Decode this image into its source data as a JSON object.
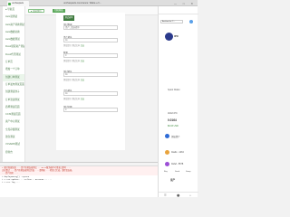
{
  "browser": {
    "tab_title": "unchaspads",
    "page_title": "unchaspads.com/vance: Waba ≡ h...",
    "window_controls": "— □ ✕"
  },
  "nav": {
    "items": [
      {
        "label": "● 导航页"
      },
      {
        "label": "Auto流测试"
      },
      {
        "label": "Auto资产转换测试"
      },
      {
        "label": "Auto数据切换"
      },
      {
        "label": "Auto数据测试"
      },
      {
        "label": "Fixed流程资产测试"
      },
      {
        "label": "Fixed代币测试"
      },
      {
        "label": "订单页"
      },
      {
        "label": "增加一个订单"
      },
      {
        "label": "创建订单测试"
      },
      {
        "label": "订单发布测试页面"
      },
      {
        "label": "创建测试池子"
      },
      {
        "label": "订单流试测试"
      },
      {
        "label": "质押测试页面"
      },
      {
        "label": "CCIS测试页面"
      },
      {
        "label": "资产中心测试"
      },
      {
        "label": "全局存储测试"
      },
      {
        "label": "钱包测试"
      },
      {
        "label": "VCVERS测试"
      },
      {
        "label": "控制台"
      }
    ]
  },
  "toolbar": {
    "btn_connect": "● 连接钱包",
    "btn_network": "切换网络"
  },
  "form": {
    "logo_label": "测试表单",
    "field1_label": "测试数据",
    "field1_value": "资产_请选择你",
    "field2_label": "资产地址",
    "field2_value": "0x",
    "field2_note": "测试提示 测试文本",
    "field3_label": "数量",
    "field3_value": "0",
    "field3_note": "测试提示 测试文本",
    "field4_label": "测试地址",
    "field4_value": "0x",
    "field4_note": "测试提示 测试文本",
    "field5_label": "合约地址",
    "field5_value": "0x",
    "field5_note": "测试提示 测试文本",
    "field6_label": "测试金额",
    "field6_value": "0",
    "note_link": "点击"
  },
  "console": {
    "lines": [
      {
        "text": "⚠ 图片新建失败 ...资产转换连接测试 ...HTTP服务器不可用或已超时 ...",
        "kind": "err"
      },
      {
        "text": "  正在重试 ...资产转换连接测试页面 ...请稍候 ...检查已完成。请检查连接。",
        "kind": "err"
      },
      {
        "text": "  ...资产转换 ...",
        "kind": "err"
      },
      {
        "text": "> deploymentQ() .sycoco",
        "kind": "plain"
      },
      {
        "text": "  > 1 rec.update: ...txline : 0x12345 -- ...",
        "kind": "plain"
      },
      {
        "text": "  > 2 err.log ...",
        "kind": "plain"
      }
    ]
  },
  "wallet": {
    "network": "Avalanche C...",
    "account_name": "IPC",
    "subtext": "Spark Wallet",
    "balance_label": "AVAX.IPC",
    "balance_value": "0.0164",
    "fiat": "$0.03 USD",
    "rows": [
      {
        "label": "添加资产",
        "color": "#2e6bd6"
      },
      {
        "label": "0xabc...1234",
        "color": "#e8a33c"
      },
      {
        "label": "0xdef...5678",
        "color": "#9c4fd6"
      }
    ],
    "actions": [
      {
        "label": "Buy"
      },
      {
        "label": "Send"
      },
      {
        "label": "Swap"
      }
    ],
    "section_title": "资产",
    "footer_items": [
      {
        "label": "☰"
      },
      {
        "label": "⬤"
      },
      {
        "label": "⌂"
      }
    ]
  },
  "colors": {
    "accent_green": "#5aa85a",
    "dark_green": "#3f7b3f",
    "wallet_blue": "#2b3a8c"
  }
}
